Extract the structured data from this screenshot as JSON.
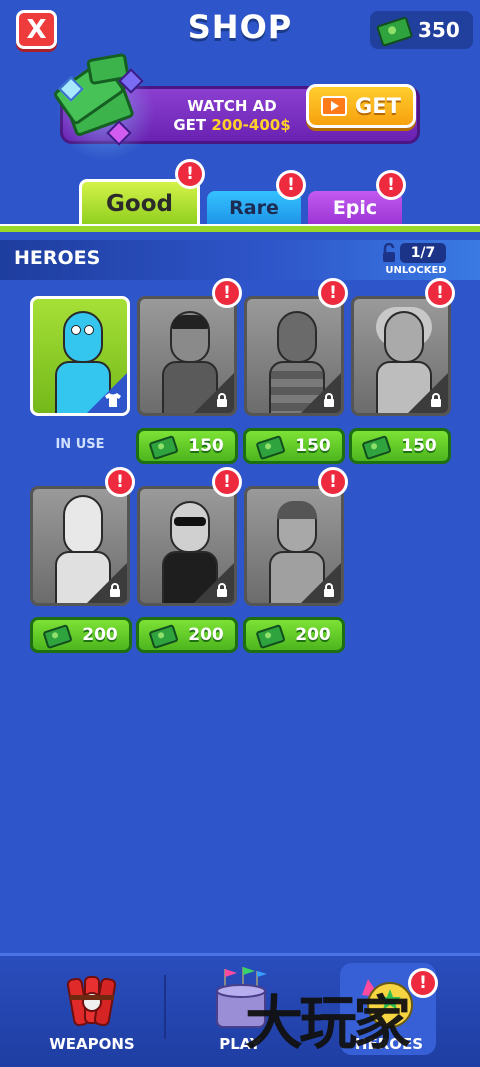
{
  "header": {
    "close_label": "X",
    "title": "SHOP",
    "currency_amount": "350"
  },
  "ad": {
    "line1": "WATCH AD",
    "line2_prefix": "GET",
    "line2_range": "200-400$",
    "button_label": "GET"
  },
  "tabs": [
    {
      "label": "Good",
      "alert": "!"
    },
    {
      "label": "Rare",
      "alert": "!"
    },
    {
      "label": "Epic",
      "alert": "!"
    }
  ],
  "section": {
    "title": "HEROES",
    "unlock_count": "1/7",
    "unlock_label": "UNLOCKED"
  },
  "heroes": [
    {
      "status": "IN USE",
      "alert": ""
    },
    {
      "price": "150",
      "alert": "!"
    },
    {
      "price": "150",
      "alert": "!"
    },
    {
      "price": "150",
      "alert": "!"
    },
    {
      "price": "200",
      "alert": "!"
    },
    {
      "price": "200",
      "alert": "!"
    },
    {
      "price": "200",
      "alert": "!"
    }
  ],
  "nav": {
    "weapons": "WEAPONS",
    "play": "PLAY",
    "heroes": "HEROES",
    "heroes_alert": "!"
  },
  "colors": {
    "background": "#2e55c9",
    "good_tab": "#9ad92a",
    "rare_tab": "#1e94e8",
    "epic_tab": "#9b34d4",
    "price_button": "#4db51e",
    "badge": "#ee2b3e",
    "get_button": "#f7a10f"
  },
  "watermark": "大玩家"
}
